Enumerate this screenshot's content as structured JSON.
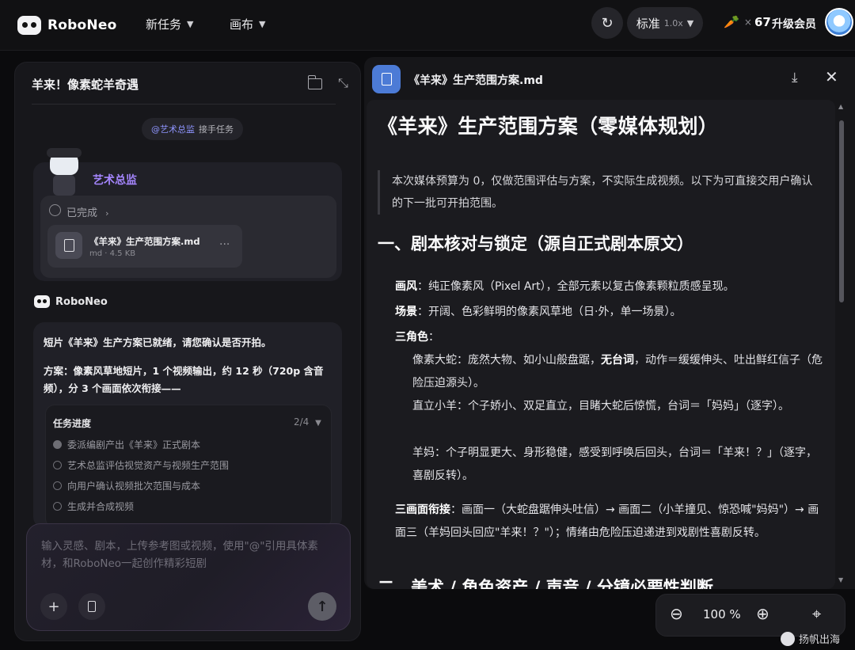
{
  "topbar": {
    "brand": "RoboNeo",
    "menu_task": "新任务",
    "menu_canvas": "画布",
    "quality_label": "标准",
    "quality_multiplier": "1.0x",
    "credits_x": "×",
    "credits_count": "67",
    "upgrade_label": "升级会员"
  },
  "chat": {
    "title": "羊来！像素蛇羊奇遇",
    "mention_name": "@艺术总监",
    "mention_suffix": "接手任务",
    "agent_name": "艺术总监",
    "done_label": "已完成",
    "file_name": "《羊来》生产范围方案.md",
    "file_meta": "md · 4.5 KB",
    "file_more": "···",
    "roboneo_name": "RoboNeo",
    "reply_line1": "短片《羊来》生产方案已就绪，请您确认是否开拍。",
    "reply_line2": "方案：像素风草地短片，1 个视频输出，约 12 秒（720p 含音",
    "reply_line3": "频），分 3 个画面依次衔接——",
    "progress_title": "任务进度",
    "progress_count": "2/4",
    "steps": [
      {
        "label": "委派编剧产出《羊来》正式剧本"
      },
      {
        "label": "艺术总监评估视觉资产与视频生产范围"
      },
      {
        "label": "向用户确认视频批次范围与成本"
      },
      {
        "label": "生成并合成视频"
      }
    ],
    "input_placeholder": "输入灵感、剧本，上传参考图或视频，使用\"@\"引用具体素材，和RoboNeo一起创作精彩短剧"
  },
  "doc": {
    "header_title": "《羊来》生产范围方案.md",
    "h1": "《羊来》生产范围方案（零媒体规划）",
    "quote": "本次媒体预算为 0，仅做范围评估与方案，不实际生成视频。以下为可直接交用户确认的下一批可开拍范围。",
    "h2": "一、剧本核对与锁定（源自正式剧本原文）",
    "p1_label": "画风",
    "p1_text": "：纯正像素风（Pixel Art），全部元素以复古像素颗粒质感呈现。",
    "p2_label": "场景",
    "p2_text": "：开阔、色彩鲜明的像素风草地（日·外，单一场景）。",
    "p3_label": "三角色",
    "p3_text": "：",
    "p4_a": "像素大蛇：庞然大物、如小山般盘踞，",
    "p4_b": "无台词",
    "p4_c": "，动作＝缓缓伸头、吐出鲜红信子（危险压迫源头）。",
    "p5": "直立小羊：个子娇小、双足直立，目睹大蛇后惊慌，台词＝「妈妈」（逐字）。",
    "p6": "羊妈：个子明显更大、身形稳健，感受到呼唤后回头，台词＝「羊来！？」（逐字，喜剧反转）。",
    "p7_label": "三画面衔接",
    "p7_text": "：画面一（大蛇盘踞伸头吐信）→ 画面二（小羊撞见、惊恐喊\"妈妈\"）→ 画面三（羊妈回头回应\"羊来！？\"）；情绪由危险压迫递进到戏剧性喜剧反转。",
    "h2b": "二、美术 / 角色资产 / 声音 / 分镜必要性判断"
  },
  "zoom": {
    "value": "100 %"
  },
  "watermark": "扬帆出海"
}
